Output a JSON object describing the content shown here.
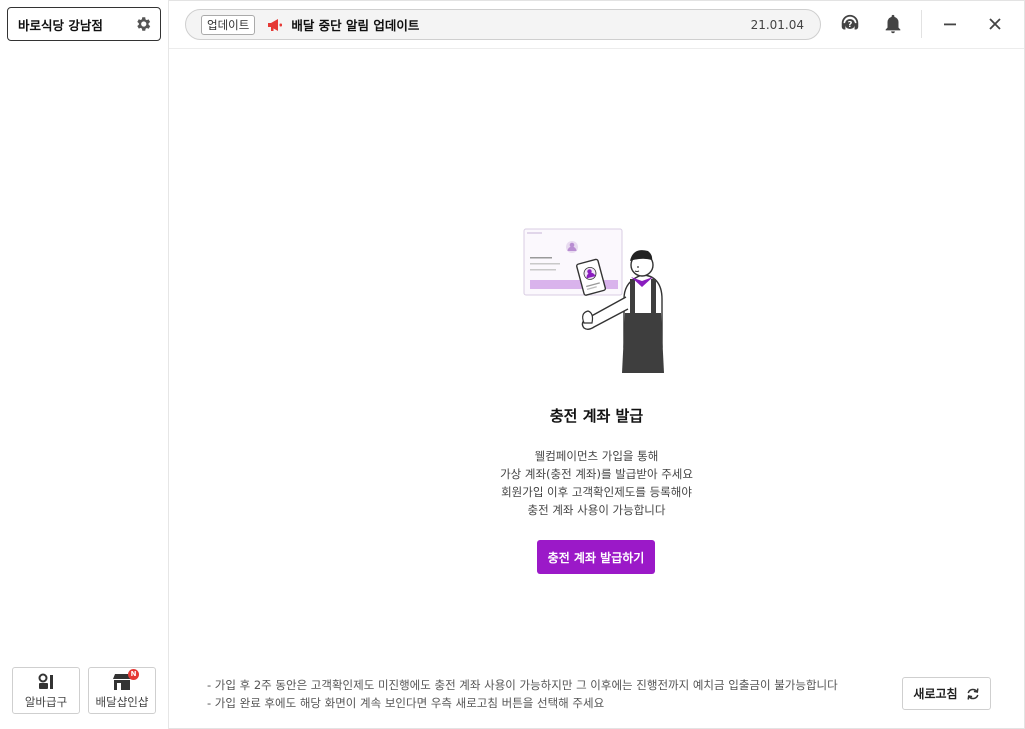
{
  "sidebar": {
    "store_name": "바로식당 강남점",
    "settings_icon": "gear-icon",
    "buttons": [
      {
        "label": "알바급구",
        "icon": "job-icon"
      },
      {
        "label": "배달샵인샵",
        "icon": "store-icon",
        "badge": "N"
      }
    ]
  },
  "header": {
    "notice_tag": "업데이트",
    "notice_icon": "megaphone-icon",
    "notice_text": "배달 중단 알림 업데이트",
    "notice_date": "21.01.04",
    "icons": [
      "help-icon",
      "bell-icon",
      "minimize-icon",
      "close-icon"
    ]
  },
  "main": {
    "title": "충전 계좌 발급",
    "description": [
      "웰컴페이먼츠 가입을 통해",
      "가상 계좌(충전 계좌)를 발급받아 주세요",
      "회원가입 이후 고객확인제도를 등록해야",
      "충전 계좌 사용이 가능합니다"
    ],
    "issue_button": "충전 계좌 발급하기",
    "notes": [
      "- 가입 후 2주 동안은 고객확인제도 미진행에도 충전 계좌 사용이 가능하지만 그 이후에는 진행전까지 예치금 입출금이 불가능합니다",
      "- 가입 완료 후에도 해당 화면이 계속 보인다면 우측 새로고침 버튼을 선택해 주세요"
    ],
    "refresh_button": "새로고침"
  },
  "colors": {
    "accent": "#9b19c8",
    "badge": "#e53935",
    "megaphone": "#e53935"
  }
}
